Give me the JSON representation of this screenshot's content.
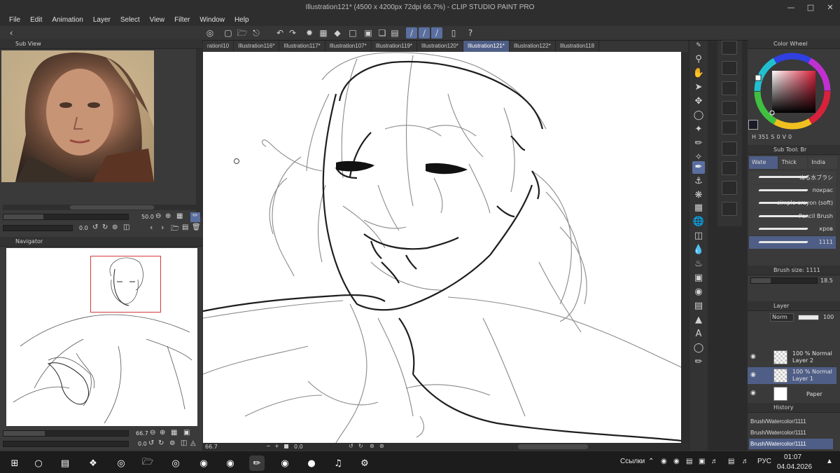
{
  "window": {
    "title": "Illustration121* (4500 x 4200px 72dpi 66.7%)  - CLIP STUDIO PAINT PRO"
  },
  "menu": [
    "File",
    "Edit",
    "Animation",
    "Layer",
    "Select",
    "View",
    "Filter",
    "Window",
    "Help"
  ],
  "tabs": [
    {
      "label": "rationI10",
      "active": false
    },
    {
      "label": "Illustration116*",
      "active": false
    },
    {
      "label": "Illustration117*",
      "active": false
    },
    {
      "label": "Illustration107*",
      "active": false
    },
    {
      "label": "Illustration119*",
      "active": false
    },
    {
      "label": "Illustration120*",
      "active": false
    },
    {
      "label": "Illustration121*",
      "active": true
    },
    {
      "label": "Illustration122*",
      "active": false
    },
    {
      "label": "Illustration118",
      "active": false
    }
  ],
  "subview": {
    "title": "Sub View",
    "zoom": "50.0",
    "zoom_fill": 0.32,
    "rotation": "0.0"
  },
  "navigator": {
    "title": "Navigator",
    "zoom": "66.7",
    "zoom_fill": 0.33,
    "rotation": "0.0"
  },
  "status": {
    "zoom": "66.7",
    "angle": "0.0"
  },
  "color_wheel": {
    "title": "Color Wheel",
    "h_label": "H",
    "h_value": "351",
    "s_label": "S",
    "s_value": "0",
    "v_label": "V",
    "v_value": "0",
    "current_color": "#1a1a2a",
    "hue_color": "#d9213b"
  },
  "subtool": {
    "title": "Sub Tool: Br",
    "tabs": [
      "Wate",
      "Thick",
      "India"
    ],
    "brushes": [
      "ぬる水ブラシ",
      "покрас",
      "simple crayon (soft)",
      "Pencil Brush",
      "кров",
      "1111"
    ]
  },
  "brush_size": {
    "title": "Brush size: 1111",
    "value": "18.5",
    "fill": 0.3
  },
  "layer": {
    "title": "Layer",
    "blend": "Norm",
    "opacity": "100",
    "layers": [
      {
        "mode": "100 % Normal",
        "name": "Layer 2",
        "selected": false
      },
      {
        "mode": "100 % Normal",
        "name": "Layer 1",
        "selected": true
      },
      {
        "mode": "",
        "name": "Paper",
        "selected": false
      }
    ]
  },
  "history": {
    "title": "History",
    "items": [
      "Brush/Watercolor/1111",
      "Brush/Watercolor/1111",
      "Brush/Watercolor/1111"
    ]
  },
  "taskbar": {
    "links_label": "Ссылки",
    "lang": "РУС",
    "time": "01:07",
    "date": "04.04.2026"
  }
}
